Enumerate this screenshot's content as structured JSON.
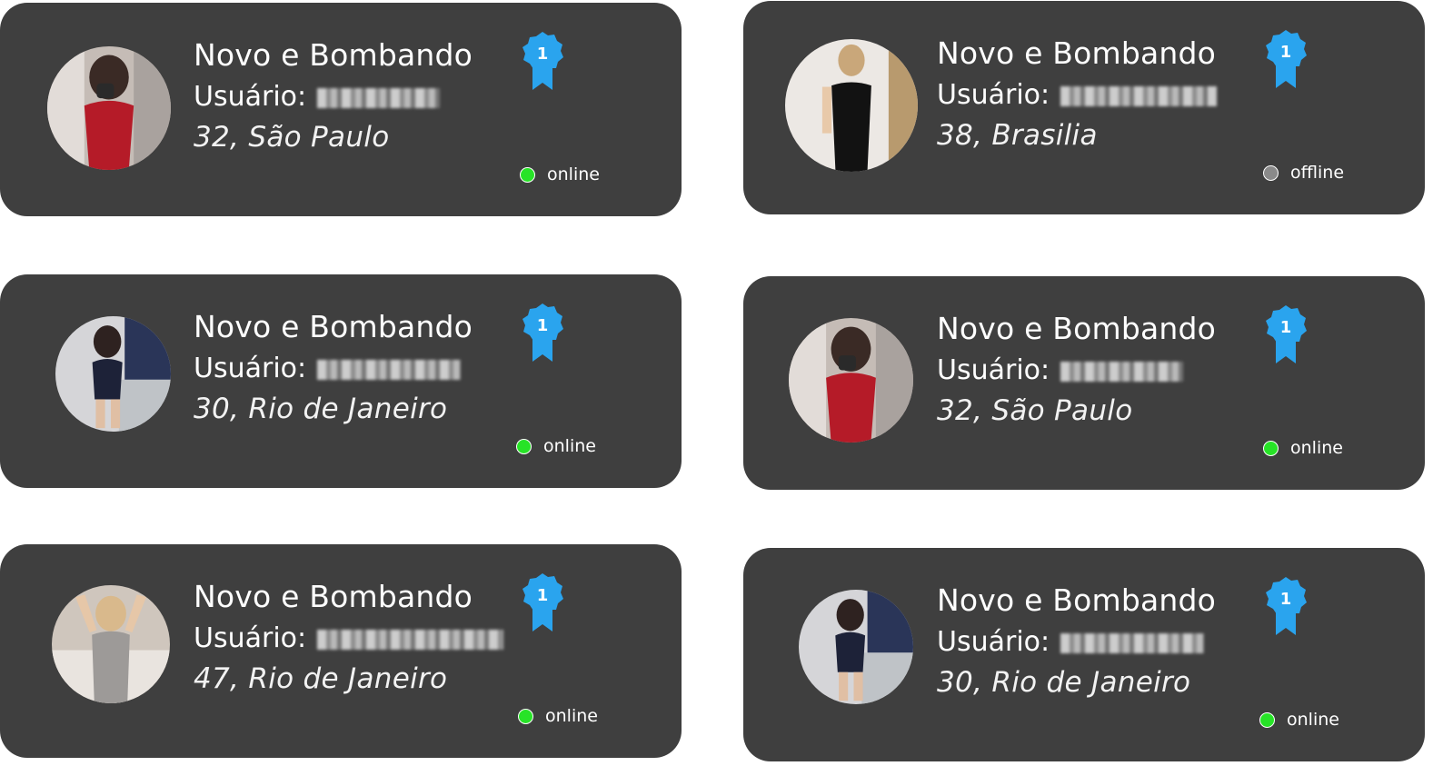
{
  "cards": [
    {
      "title": "Novo e Bombando",
      "user_label": "Usuário:",
      "location": "32, São Paulo",
      "badge_number": "1",
      "status": "online",
      "status_color": "#27e327",
      "photo_bg": "#c5bcb6",
      "photo_accent": "#b51b28"
    },
    {
      "title": "Novo e Bombando",
      "user_label": "Usuário:",
      "location": "38, Brasilia",
      "badge_number": "1",
      "status": "offline",
      "status_color": "#8a8a8a",
      "photo_bg": "#ece8e4",
      "photo_accent": "#121212"
    },
    {
      "title": "Novo e Bombando",
      "user_label": "Usuário:",
      "location": "30, Rio de Janeiro",
      "badge_number": "1",
      "status": "online",
      "status_color": "#27e327",
      "photo_bg": "#d5d5d8",
      "photo_accent": "#1d2238"
    },
    {
      "title": "Novo e Bombando",
      "user_label": "Usuário:",
      "location": "32, São Paulo",
      "badge_number": "1",
      "status": "online",
      "status_color": "#27e327",
      "photo_bg": "#c5bcb6",
      "photo_accent": "#b51b28"
    },
    {
      "title": "Novo e Bombando",
      "user_label": "Usuário:",
      "location": "47, Rio de Janeiro",
      "badge_number": "1",
      "status": "online",
      "status_color": "#27e327",
      "photo_bg": "#cfc6bd",
      "photo_accent": "#9d9a98"
    },
    {
      "title": "Novo e Bombando",
      "user_label": "Usuário:",
      "location": "30, Rio de Janeiro",
      "badge_number": "1",
      "status": "online",
      "status_color": "#27e327",
      "photo_bg": "#d5d5d8",
      "photo_accent": "#1d2238"
    }
  ],
  "colors": {
    "card_bg": "#3f3f3f",
    "badge_blue": "#2aa4ee",
    "text": "#ffffff"
  },
  "icons": {
    "badge": "award-ribbon-icon",
    "status": "status-dot-icon"
  }
}
